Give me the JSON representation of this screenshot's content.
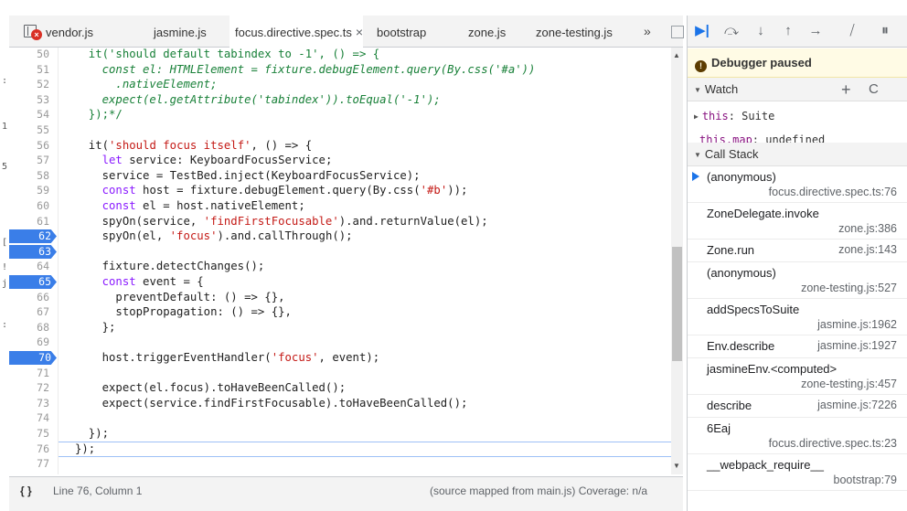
{
  "tabs": [
    {
      "label": "vendor.js",
      "error": true
    },
    {
      "label": "jasmine.js"
    },
    {
      "label": "focus.directive.spec.ts",
      "active": true
    },
    {
      "label": "bootstrap"
    },
    {
      "label": "zone.js"
    },
    {
      "label": "zone-testing.js"
    }
  ],
  "tab_more": "»",
  "left_strip": [
    ":",
    "1",
    "5",
    "[",
    "!",
    "j",
    ":"
  ],
  "editor": {
    "lines": [
      {
        "n": "50",
        "text": "  it('should default tabindex to -1', () => {",
        "comment": true
      },
      {
        "n": "51",
        "text": "    const el: HTMLElement = fixture.debugElement.query(By.css('#a'))",
        "comment": true
      },
      {
        "n": "52",
        "text": "      .nativeElement;",
        "comment": true
      },
      {
        "n": "53",
        "text": "    expect(el.getAttribute('tabindex')).toEqual('-1');",
        "comment": true
      },
      {
        "n": "54",
        "text": "  });*/",
        "comment": true
      },
      {
        "n": "55",
        "text": ""
      },
      {
        "n": "56",
        "text": "  it('should focus itself', () => {"
      },
      {
        "n": "57",
        "text": "    let service: KeyboardFocusService;"
      },
      {
        "n": "58",
        "text": "    service = TestBed.inject(KeyboardFocusService);"
      },
      {
        "n": "59",
        "text": "    const host = fixture.debugElement.query(By.css('#b'));"
      },
      {
        "n": "60",
        "text": "    const el = host.nativeElement;"
      },
      {
        "n": "61",
        "text": "    spyOn(service, 'findFirstFocusable').and.returnValue(el);"
      },
      {
        "n": "62",
        "text": "    spyOn(el, 'focus').and.callThrough();",
        "bp": true
      },
      {
        "n": "63",
        "text": "",
        "bp": true
      },
      {
        "n": "64",
        "text": "    fixture.detectChanges();"
      },
      {
        "n": "65",
        "text": "    const event = {",
        "bp": true
      },
      {
        "n": "66",
        "text": "      preventDefault: () => {},"
      },
      {
        "n": "67",
        "text": "      stopPropagation: () => {},"
      },
      {
        "n": "68",
        "text": "    };"
      },
      {
        "n": "69",
        "text": ""
      },
      {
        "n": "70",
        "text": "    host.triggerEventHandler('focus', event);",
        "bp": true
      },
      {
        "n": "71",
        "text": ""
      },
      {
        "n": "72",
        "text": "    expect(el.focus).toHaveBeenCalled();"
      },
      {
        "n": "73",
        "text": "    expect(service.findFirstFocusable).toHaveBeenCalled();"
      },
      {
        "n": "74",
        "text": ""
      },
      {
        "n": "75",
        "text": "  });"
      },
      {
        "n": "76",
        "text": "});",
        "current": true
      },
      {
        "n": "77",
        "text": ""
      }
    ]
  },
  "status": {
    "position": "Line 76, Column 1",
    "source": "(source mapped from main.js) Coverage: n/a"
  },
  "debugger": {
    "paused_label": "Debugger paused",
    "watch_label": "Watch",
    "watch_add": "+",
    "watch_refresh": "C",
    "watch_items": [
      {
        "key": "this",
        "value": ": Suite",
        "expandable": true
      },
      {
        "key": "this.map",
        "value": ": undefined",
        "expandable": false
      }
    ],
    "callstack_label": "Call Stack",
    "frames": [
      {
        "fn": "(anonymous)",
        "loc": "focus.directive.spec.ts:76",
        "current": true,
        "two_line": true
      },
      {
        "fn": "ZoneDelegate.invoke",
        "loc": "zone.js:386",
        "two_line": true
      },
      {
        "fn": "Zone.run",
        "loc": "zone.js:143",
        "two_line": false
      },
      {
        "fn": "(anonymous)",
        "loc": "zone-testing.js:527",
        "two_line": true
      },
      {
        "fn": "addSpecsToSuite",
        "loc": "jasmine.js:1962",
        "two_line": true
      },
      {
        "fn": "Env.describe",
        "loc": "jasmine.js:1927",
        "two_line": false
      },
      {
        "fn": "jasmineEnv.<computed>",
        "loc": "zone-testing.js:457",
        "two_line": true
      },
      {
        "fn": "describe",
        "loc": "jasmine.js:7226",
        "two_line": false
      },
      {
        "fn": "6Eaj",
        "loc": "focus.directive.spec.ts:23",
        "two_line": true
      },
      {
        "fn": "__webpack_require__",
        "loc": "bootstrap:79",
        "two_line": true
      }
    ]
  },
  "colors": {
    "breakpoint": "#3a7ee8",
    "paused_bg": "#fffbe5",
    "accent": "#1a73e8"
  }
}
